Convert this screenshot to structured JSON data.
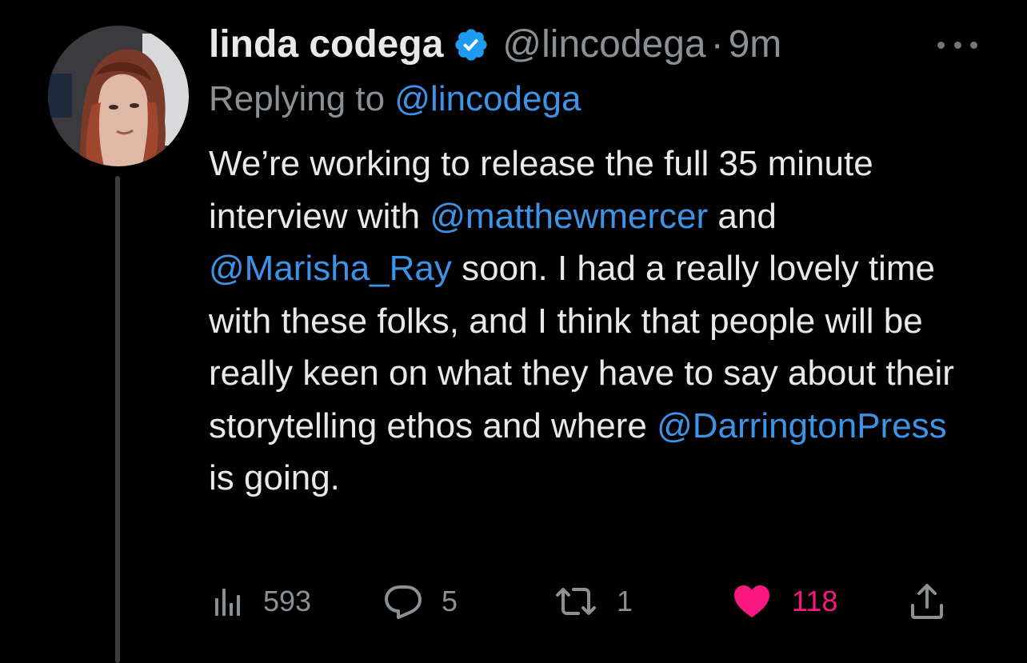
{
  "tweet": {
    "display_name": "linda codega",
    "handle": "@lincodega",
    "separator": "·",
    "time": "9m",
    "replying_label": "Replying to",
    "replying_handle": "@lincodega",
    "body": [
      {
        "text": "We’re working to release the full 35 minute interview with ",
        "link": false
      },
      {
        "text": "@matthewmercer",
        "link": true
      },
      {
        "text": " and ",
        "link": false
      },
      {
        "text": "@Marisha_Ray",
        "link": true
      },
      {
        "text": " soon. I had a really lovely time with these folks, and I think that people will be really keen on what they have to say about their storytelling ethos and where ",
        "link": false
      },
      {
        "text": "@DarringtonPress",
        "link": true
      },
      {
        "text": " is going.",
        "link": false
      }
    ]
  },
  "actions": {
    "views": {
      "icon": "views-icon",
      "count": "593"
    },
    "replies": {
      "icon": "reply-icon",
      "count": "5"
    },
    "retweets": {
      "icon": "retweet-icon",
      "count": "1"
    },
    "likes": {
      "icon": "heart-icon",
      "count": "118",
      "liked": true
    },
    "share": {
      "icon": "share-icon"
    }
  },
  "colors": {
    "background": "#000000",
    "text": "#e7e9ea",
    "secondary": "#8b9095",
    "link": "#3d94e6",
    "like": "#f91880",
    "verified": "#1d9bf0"
  }
}
